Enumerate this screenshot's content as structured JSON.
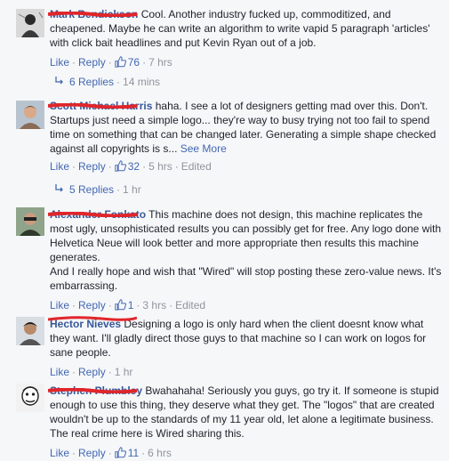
{
  "comments": [
    {
      "author": "Mark Bendickson",
      "text": "Cool. Another industry fucked up, commoditized, and cheapened. Maybe he can write an algorithm to write vapid 5 paragraph 'articles' with click bait headlines and put Kevin Ryan out of a job.",
      "like_label": "Like",
      "reply_label": "Reply",
      "like_count": "76",
      "time": "7 hrs",
      "replies_label": "6 Replies",
      "replies_time": "14 mins"
    },
    {
      "author": "Scott Michael Harris",
      "text": "haha. I see a lot of designers getting mad over this. Don't. Startups just need a simple logo... they're way to busy trying not too fail to spend time on something that can be changed later. Generating a simple shape checked against all copyrights is s...",
      "see_more": "See More",
      "like_label": "Like",
      "reply_label": "Reply",
      "like_count": "32",
      "time": "5 hrs",
      "edited": "Edited",
      "replies_label": "5 Replies",
      "replies_time": "1 hr"
    },
    {
      "author": "Alexander Fonkato",
      "text_lines": [
        "This machine does not design, this machine replicates the most ugly, unsophisticated results you can possibly get for free. Any logo done with Helvetica Neue will look better and more appropriate then results this machine generates.",
        "And I really hope and wish that \"Wired\" will stop posting these zero-value news. It's embarrassing."
      ],
      "like_label": "Like",
      "reply_label": "Reply",
      "like_count": "1",
      "time": "3 hrs",
      "edited": "Edited"
    },
    {
      "author": "Hector Nieves",
      "text": "Designing a logo is only hard when the client doesnt know what they want. I'll gladly direct those guys to that machine so I can work on logos for sane people.",
      "like_label": "Like",
      "reply_label": "Reply",
      "time": "1 hr"
    },
    {
      "author": "Stephen Plumbley",
      "text": "Bwahahaha! Seriously you guys, go try it. If someone is stupid enough to use this thing, they deserve what they get. The \"logos\" that are created wouldn't be up to the standards of my 11 year old, let alone a legitimate business. The real crime here is Wired sharing this.",
      "like_label": "Like",
      "reply_label": "Reply",
      "like_count": "11",
      "time": "6 hrs"
    }
  ],
  "colors": {
    "link": "#4267b2",
    "author": "#365899",
    "meta": "#90949c",
    "scribble": "#e0262b",
    "background": "#f6f7f9"
  },
  "icons": {
    "thumb": "thumbs-up-icon",
    "reply_arrow": "reply-arrow-icon"
  }
}
